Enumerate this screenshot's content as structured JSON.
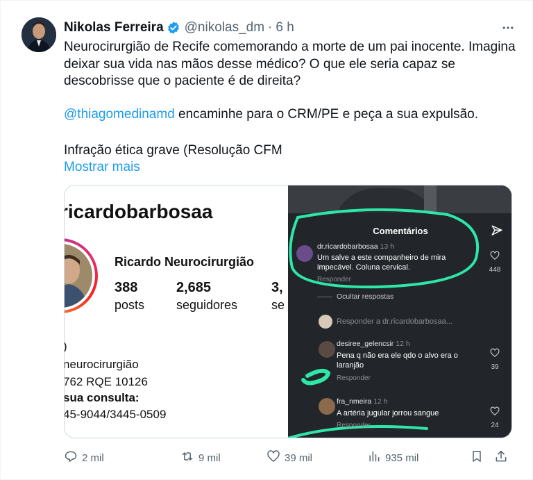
{
  "tweet": {
    "author_name": "Nikolas Ferreira",
    "handle": "@nikolas_dm",
    "separator": "·",
    "time": "6 h",
    "paragraph1": "Neurocirurgião de Recife comemorando a morte de um pai inocente. Imagina deixar sua vida nas mãos desse médico? O que ele seria capaz se descobrisse que o paciente é de direita?",
    "mention": "@thiagomedinamd",
    "paragraph2_rest": " encaminhe para o CRM/PE e peça a sua expulsão.",
    "paragraph3": "Infração ética grave (Resolução CFM",
    "show_more": "Mostrar mais"
  },
  "media": {
    "profile": {
      "username": "ricardobarbosaa",
      "full_name": "Ricardo Neurocirurgião",
      "posts_count": "388",
      "posts_label": "posts",
      "followers_count": "2,685",
      "followers_label": "seguidores",
      "following_count": "3,",
      "following_label": "se",
      "bio_line1": ")",
      "bio_line2": "neurocirurgião",
      "bio_line3": "762 RQE 10126",
      "bio_line4": "sua consulta:",
      "bio_line5": "45-9044/3445-0509"
    },
    "comments": {
      "title": "Comentários",
      "items": [
        {
          "user": "dr.ricardobarbosaa",
          "ago": "13 h",
          "text": "Um salve a este companheiro de mira impecável. Coluna cervical.",
          "reply": "Responder",
          "likes": "448"
        },
        {
          "user": "desiree_gelencsir",
          "ago": "12 h",
          "text": "Pena q não era ele qdo o alvo era o laranjão",
          "reply": "Responder",
          "likes": "39"
        },
        {
          "user": "fra_nmeira",
          "ago": "12 h",
          "text": "A artéria jugular jorrou sangue",
          "reply": "Responder",
          "likes": "24"
        }
      ],
      "hide_replies": "Ocultar respostas",
      "reply_prompt": "Responder a dr.ricardobarbosaa..."
    }
  },
  "actions": {
    "replies": "2 mil",
    "reposts": "9 mil",
    "likes": "39 mil",
    "views": "935 mil"
  },
  "colors": {
    "link": "#1d9bf0",
    "muted": "#536471",
    "verified": "#1d9bf0",
    "highlight": "#2ee6a8"
  },
  "icons": [
    "verified-badge-icon",
    "more-icon",
    "send-icon",
    "heart-icon",
    "reply-icon",
    "repost-icon",
    "like-icon",
    "views-icon",
    "bookmark-icon",
    "share-icon"
  ]
}
